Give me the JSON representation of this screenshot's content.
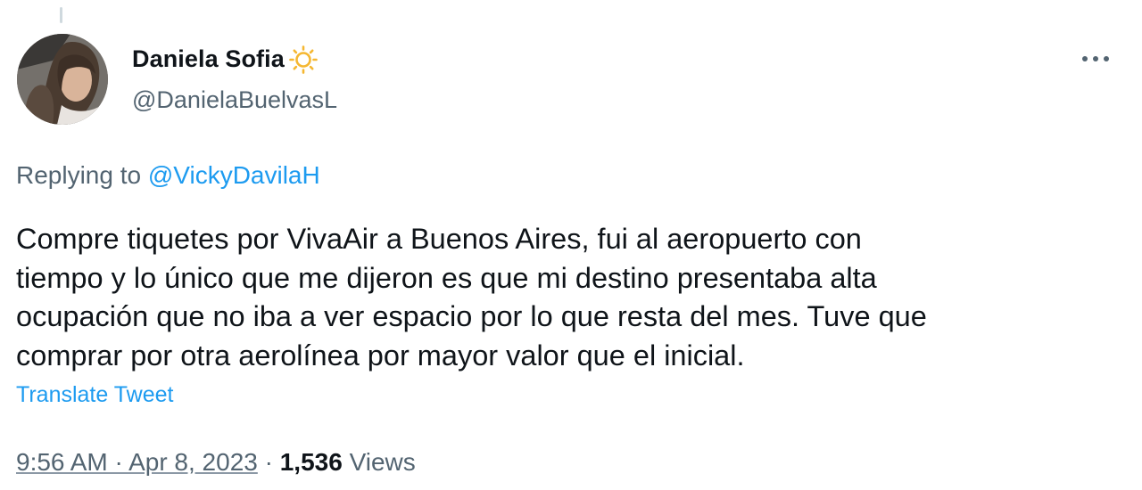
{
  "tweet": {
    "author": {
      "display_name": "Daniela Sofia",
      "handle": "@DanielaBuelvasL",
      "name_emoji_icon": "sun-icon",
      "avatar_icon": "profile-photo"
    },
    "reply": {
      "prefix": "Replying to ",
      "to_handle": "@VickyDavilaH"
    },
    "text_lines": [
      "Compre tiquetes por VivaAir a Buenos Aires, fui al aeropuerto con",
      "tiempo y lo único que me dijeron es que mi destino presentaba alta",
      "ocupación que no iba a ver espacio por lo que resta del mes. Tuve que",
      "comprar por otra aerolínea por mayor valor que el inicial."
    ],
    "translate_label": "Translate Tweet",
    "timestamp": "9:56 AM · Apr 8, 2023",
    "separator": " · ",
    "views_count": "1,536",
    "views_label": " Views",
    "more_icon": "more-options-icon"
  },
  "colors": {
    "text_primary": "#0f1419",
    "text_secondary": "#536471",
    "link": "#1d9bf0",
    "emoji_sun": "#f5b731"
  }
}
